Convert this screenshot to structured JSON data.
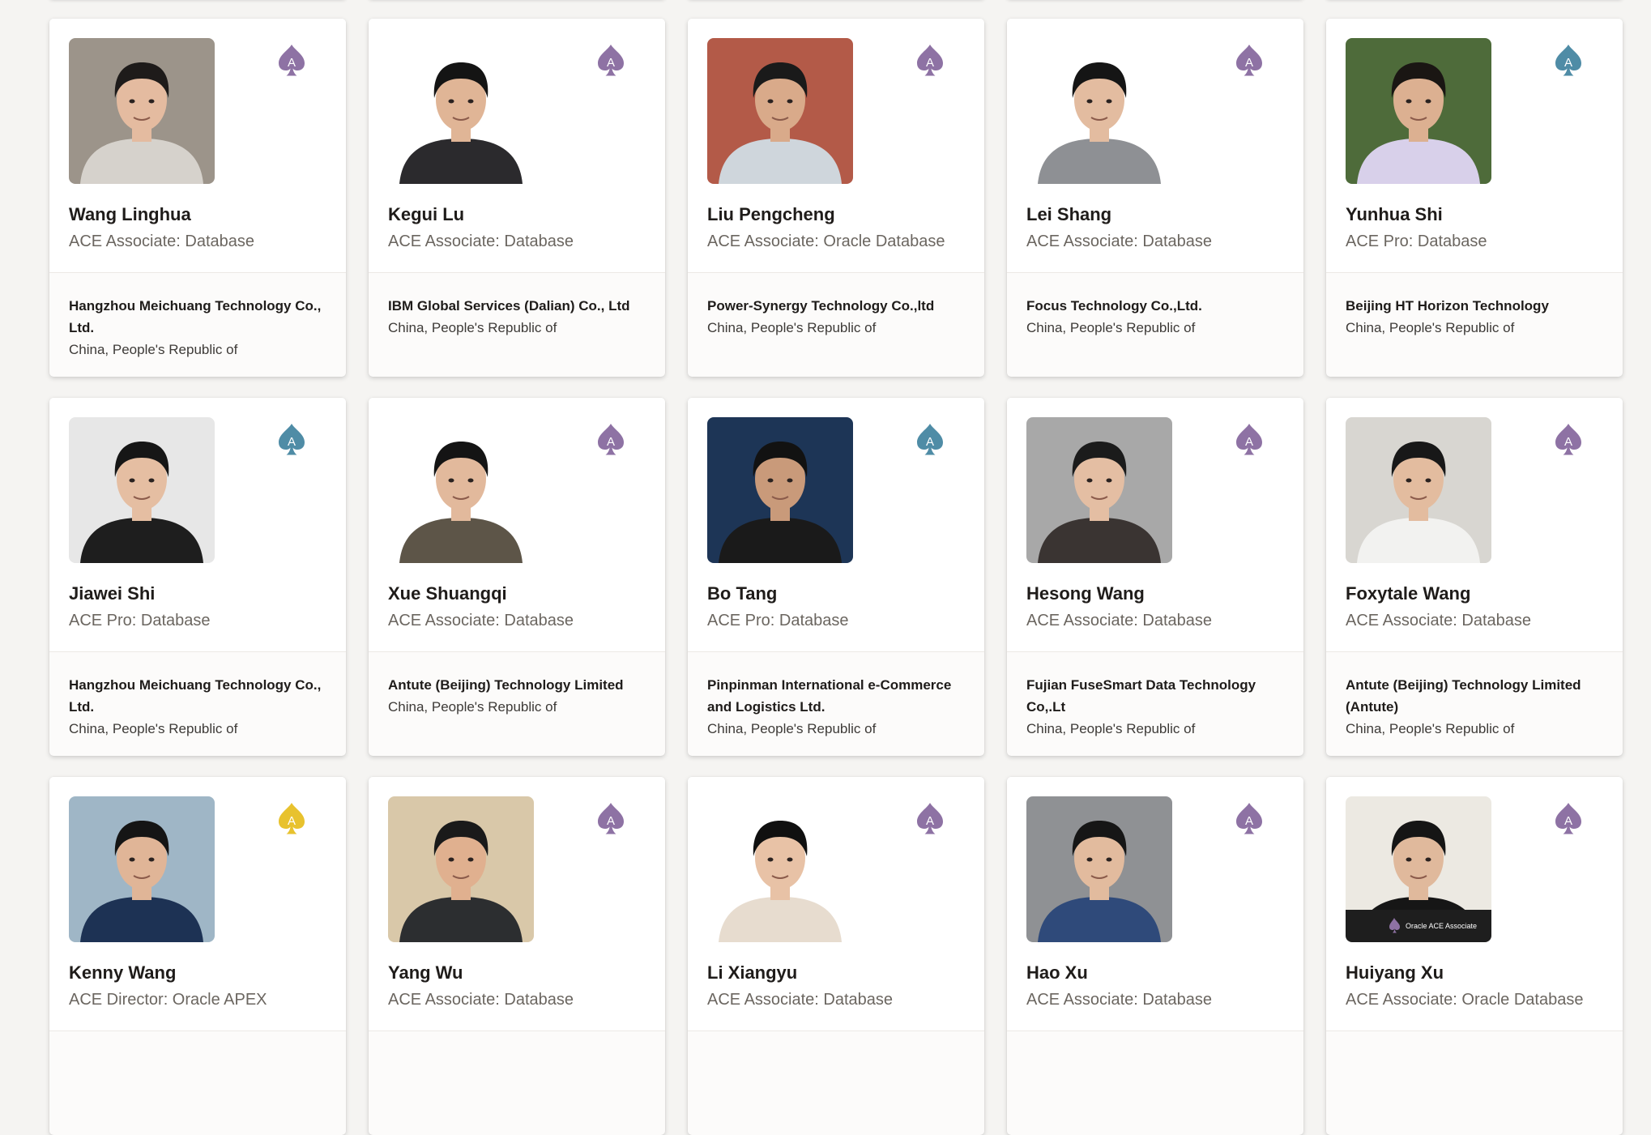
{
  "colors": {
    "ace_associate": "#8e72a4",
    "ace_pro": "#4f8ca6",
    "ace_director": "#e8c22e"
  },
  "members": [
    {
      "name": "Wang Linghua",
      "role": "ACE Associate: Database",
      "company": "Hangzhou Meichuang Technology Co., Ltd.",
      "country": "China, People's Republic of",
      "ace_level": "associate",
      "ace_letter": "A",
      "photo_colors": {
        "bg": "#9c948a",
        "skin": "#e4bba0",
        "hair": "#1e1b1a",
        "shirt": "#d6d2cc"
      }
    },
    {
      "name": "Kegui Lu",
      "role": "ACE Associate: Database",
      "company": "IBM Global Services (Dalian) Co., Ltd",
      "country": "China, People's Republic of",
      "ace_level": "associate",
      "ace_letter": "A",
      "photo_colors": {
        "bg": "#ffffff",
        "skin": "#e0b596",
        "hair": "#141414",
        "shirt": "#2b2a2d"
      }
    },
    {
      "name": "Liu Pengcheng",
      "role": "ACE Associate: Oracle Database",
      "company": "Power-Synergy Technology Co.,ltd",
      "country": "China, People's Republic of",
      "ace_level": "associate",
      "ace_letter": "A",
      "photo_colors": {
        "bg": "#b35a48",
        "skin": "#d9aa8a",
        "hair": "#1a1a1a",
        "shirt": "#cfd6dc"
      }
    },
    {
      "name": "Lei Shang",
      "role": "ACE Associate: Database",
      "company": "Focus Technology Co.,Ltd.",
      "country": "China, People's Republic of",
      "ace_level": "associate",
      "ace_letter": "A",
      "photo_colors": {
        "bg": "#ffffff",
        "skin": "#e3bca0",
        "hair": "#151515",
        "shirt": "#8e9094"
      }
    },
    {
      "name": "Yunhua Shi",
      "role": "ACE Pro: Database",
      "company": "Beijing HT Horizon Technology",
      "country": "China, People's Republic of",
      "ace_level": "pro",
      "ace_letter": "A",
      "photo_colors": {
        "bg": "#4e6b3a",
        "skin": "#dcb091",
        "hair": "#1a1613",
        "shirt": "#d8d0ea"
      }
    },
    {
      "name": "Jiawei Shi",
      "role": "ACE Pro: Database",
      "company": "Hangzhou Meichuang Technology Co., Ltd.",
      "country": "China, People's Republic of",
      "ace_level": "pro",
      "ace_letter": "A",
      "photo_colors": {
        "bg": "#e7e7e7",
        "skin": "#e5bea2",
        "hair": "#161616",
        "shirt": "#1e1e1e"
      }
    },
    {
      "name": "Xue Shuangqi",
      "role": "ACE Associate: Database",
      "company": "Antute (Beijing) Technology Limited",
      "country": "China, People's Republic of",
      "ace_level": "associate",
      "ace_letter": "A",
      "photo_colors": {
        "bg": "#ffffff",
        "skin": "#e2b99c",
        "hair": "#141414",
        "shirt": "#5d5548"
      }
    },
    {
      "name": "Bo Tang",
      "role": "ACE Pro: Database",
      "company": "Pinpinman International e-Commerce and Logistics Ltd.",
      "country": "China, People's Republic of",
      "ace_level": "pro",
      "ace_letter": "A",
      "photo_colors": {
        "bg": "#1d3556",
        "skin": "#c99a7a",
        "hair": "#121212",
        "shirt": "#1a1a1a"
      }
    },
    {
      "name": "Hesong Wang",
      "role": "ACE Associate: Database",
      "company": "Fujian FuseSmart Data Technology Co,.Lt",
      "country": "China, People's Republic of",
      "ace_level": "associate",
      "ace_letter": "A",
      "photo_colors": {
        "bg": "#a8a8a8",
        "skin": "#e4bea3",
        "hair": "#1b1b1b",
        "shirt": "#3a3432"
      }
    },
    {
      "name": "Foxytale Wang",
      "role": "ACE Associate: Database",
      "company": "Antute (Beijing) Technology Limited (Antute)",
      "country": "China, People's Republic of",
      "ace_level": "associate",
      "ace_letter": "A",
      "photo_colors": {
        "bg": "#d8d6d1",
        "skin": "#e3bc9f",
        "hair": "#181818",
        "shirt": "#f2f2f0"
      }
    },
    {
      "name": "Kenny Wang",
      "role": "ACE Director: Oracle APEX",
      "company": "",
      "country": "",
      "ace_level": "director",
      "ace_letter": "A",
      "photo_colors": {
        "bg": "#9fb6c6",
        "skin": "#e0b597",
        "hair": "#151515",
        "shirt": "#1d3254"
      }
    },
    {
      "name": "Yang Wu",
      "role": "ACE Associate: Database",
      "company": "",
      "country": "",
      "ace_level": "associate",
      "ace_letter": "A",
      "photo_colors": {
        "bg": "#d9c8a9",
        "skin": "#e0b08f",
        "hair": "#1a1a1a",
        "shirt": "#2c2e30"
      }
    },
    {
      "name": "Li Xiangyu",
      "role": "ACE Associate: Database",
      "company": "",
      "country": "",
      "ace_level": "associate",
      "ace_letter": "A",
      "photo_colors": {
        "bg": "#ffffff",
        "skin": "#e8c2a6",
        "hair": "#101010",
        "shirt": "#e7dccf"
      }
    },
    {
      "name": "Hao Xu",
      "role": "ACE Associate: Database",
      "company": "",
      "country": "",
      "ace_level": "associate",
      "ace_letter": "A",
      "photo_colors": {
        "bg": "#8f9194",
        "skin": "#e2bb9e",
        "hair": "#161616",
        "shirt": "#2f4a7a"
      }
    },
    {
      "name": "Huiyang Xu",
      "role": "ACE Associate: Oracle Database",
      "company": "",
      "country": "",
      "ace_level": "associate",
      "ace_letter": "A",
      "photo_colors": {
        "bg": "#ece9e2",
        "skin": "#e0b99c",
        "hair": "#151515",
        "shirt": "#161616"
      },
      "photo_badge": "Oracle ACE Associate"
    }
  ]
}
